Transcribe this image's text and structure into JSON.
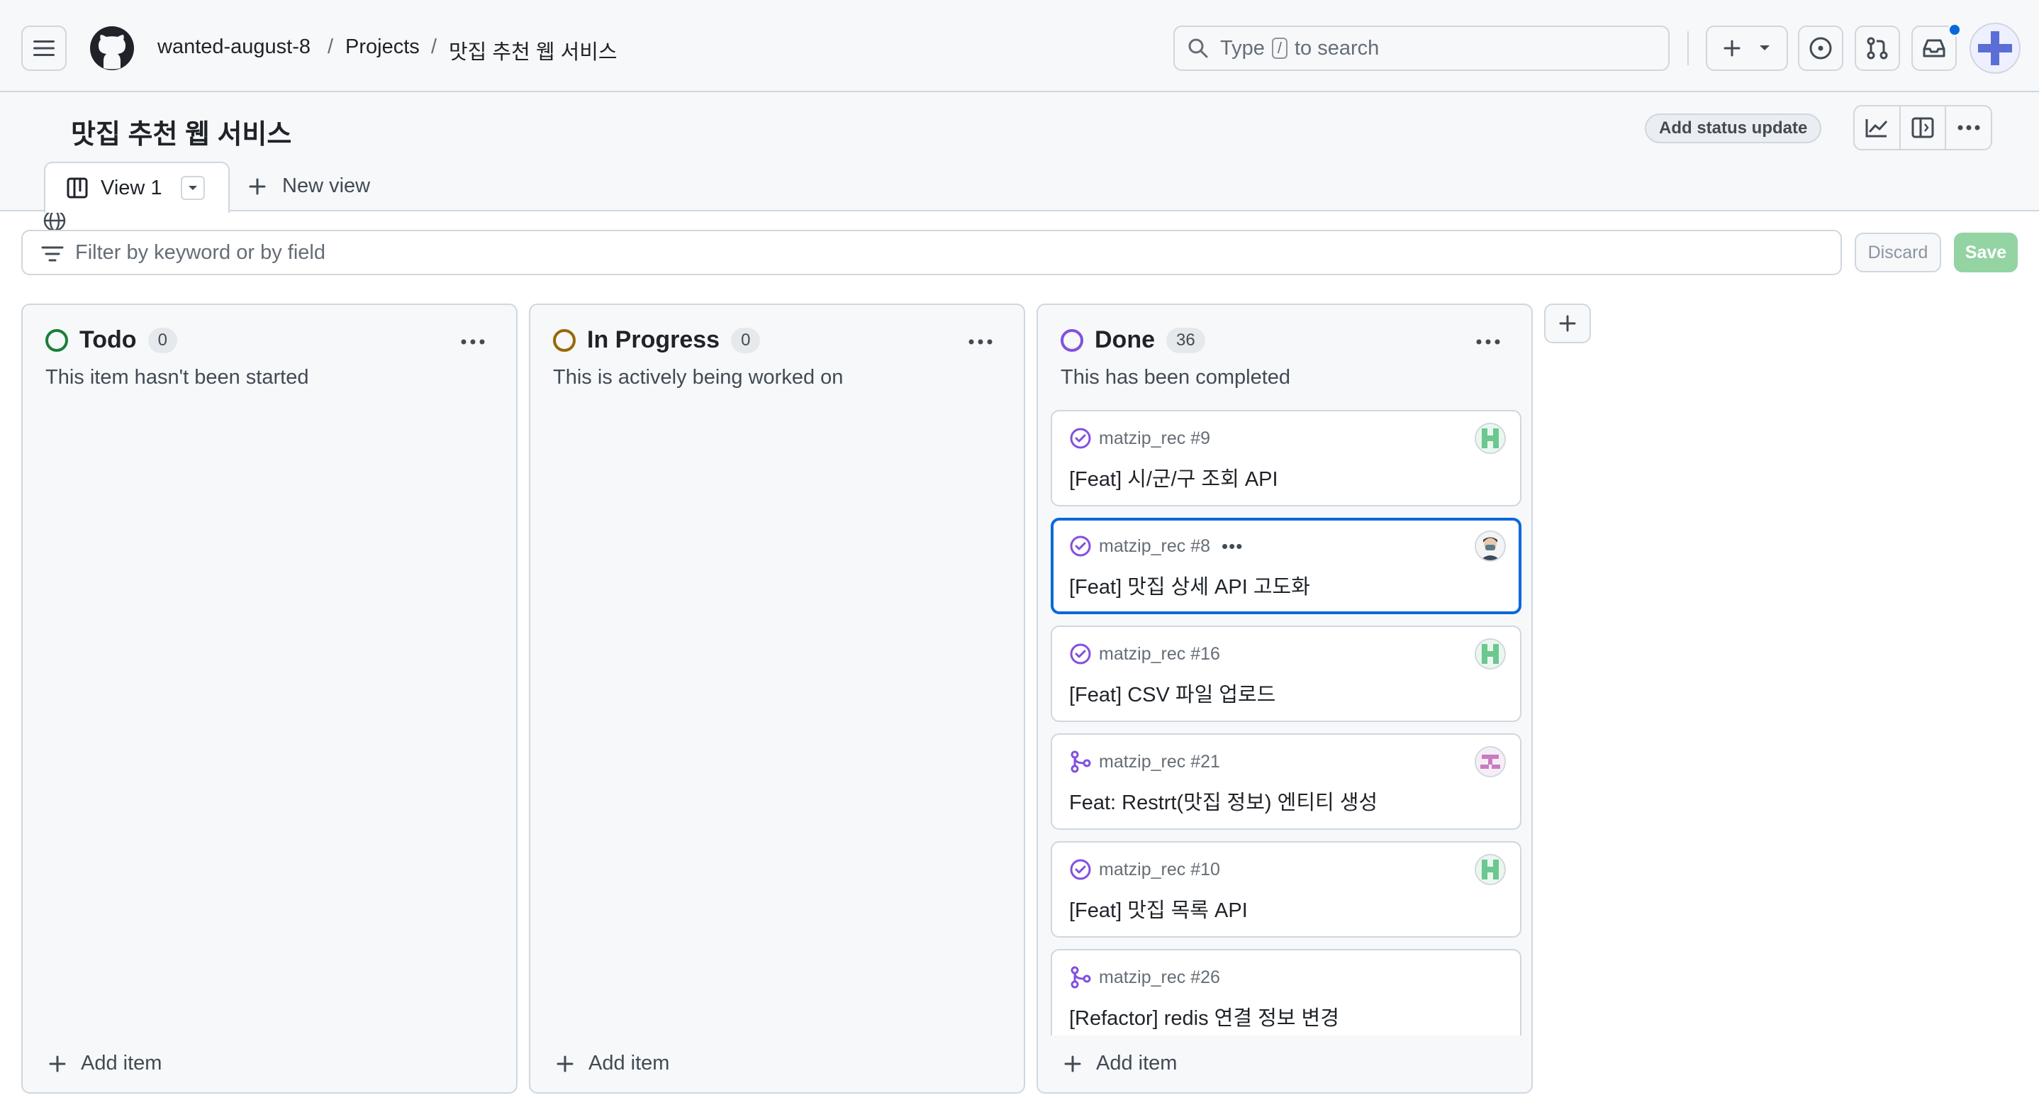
{
  "breadcrumbs": {
    "org": "wanted-august-8",
    "projects": "Projects",
    "project": "맛집 추천 웹 서비스",
    "sep": "/"
  },
  "search": {
    "prefix": "Type",
    "key": "/",
    "suffix": "to search"
  },
  "project": {
    "title": "맛집 추천 웹 서비스",
    "status_button": "Add status update"
  },
  "views": {
    "active_tab": "View 1",
    "new_view": "New view"
  },
  "filter": {
    "placeholder": "Filter by keyword or by field",
    "discard": "Discard",
    "save": "Save"
  },
  "columns": [
    {
      "title": "Todo",
      "count": "0",
      "description": "This item hasn't been started",
      "color": "#1a7f37",
      "add_item": "Add item"
    },
    {
      "title": "In Progress",
      "count": "0",
      "description": "This is actively being worked on",
      "color": "#9a6700",
      "add_item": "Add item"
    },
    {
      "title": "Done",
      "count": "36",
      "description": "This has been completed",
      "color": "#8250df",
      "add_item": "Add item",
      "cards": [
        {
          "repo": "matzip_rec #9",
          "title": "[Feat] 시/군/구 조회 API",
          "kind": "issue-closed-icon"
        },
        {
          "repo": "matzip_rec #8",
          "title": "[Feat] 맛집 상세 API 고도화",
          "kind": "issue-closed-icon",
          "menu": "•••"
        },
        {
          "repo": "matzip_rec #16",
          "title": "[Feat] CSV 파일 업로드",
          "kind": "issue-closed-icon"
        },
        {
          "repo": "matzip_rec #21",
          "title": "Feat: Restrt(맛집 정보) 엔티티 생성",
          "kind": "pull-request-merged-icon"
        },
        {
          "repo": "matzip_rec #10",
          "title": "[Feat] 맛집 목록 API",
          "kind": "issue-closed-icon"
        },
        {
          "repo": "matzip_rec #26",
          "title": "[Refactor] redis 연결 정보 변경",
          "kind": "pull-request-merged-icon"
        }
      ]
    }
  ],
  "colors": {
    "accent": "#0969da",
    "done_purple": "#8250df",
    "save_green": "#94d3a2"
  }
}
